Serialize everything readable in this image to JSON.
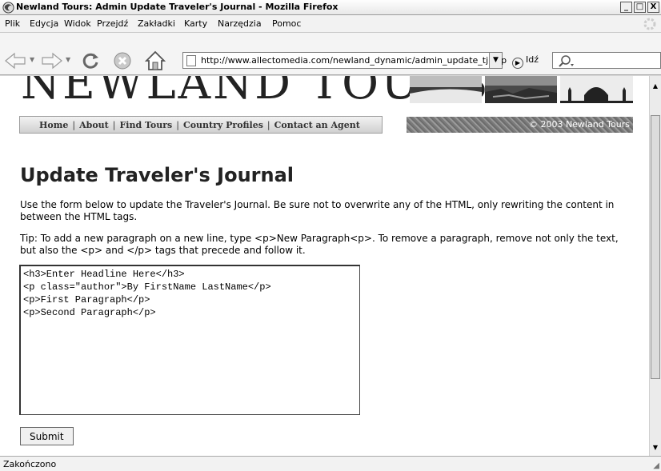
{
  "window": {
    "title": "Newland Tours: Admin Update Traveler's Journal - Mozilla Firefox",
    "minimize": "_",
    "maximize": "□",
    "close": "X"
  },
  "menu": [
    "Plik",
    "Edycja",
    "Widok",
    "Przejdź",
    "Zakładki",
    "Karty",
    "Narzędzia",
    "Pomoc"
  ],
  "toolbar": {
    "url": "http://www.allectomedia.com/newland_dynamic/admin_update_tj.asp",
    "go_label": "Idź"
  },
  "site": {
    "logo": "NEWLAND TOURS",
    "nav": [
      "Home",
      "About",
      "Find Tours",
      "Country Profiles",
      "Contact an Agent"
    ],
    "copyright": "© 2003 Newland Tours"
  },
  "page": {
    "heading": "Update Traveler's Journal",
    "intro": "Use the form below to update the Traveler's Journal. Be sure not to overwrite any of the HTML, only rewriting the content in between the HTML tags.",
    "tip": "Tip: To add a new paragraph on a new line, type <p>New Paragraph<p>. To remove a paragraph, remove not only the text, but also the <p> and </p> tags that precede and follow it.",
    "journal_content": "<h3>Enter Headline Here</h3>\n<p class=\"author\">By FirstName LastName</p>\n<p>First Paragraph</p>\n<p>Second Paragraph</p>",
    "submit_label": "Submit"
  },
  "status": {
    "text": "Zakończono"
  }
}
